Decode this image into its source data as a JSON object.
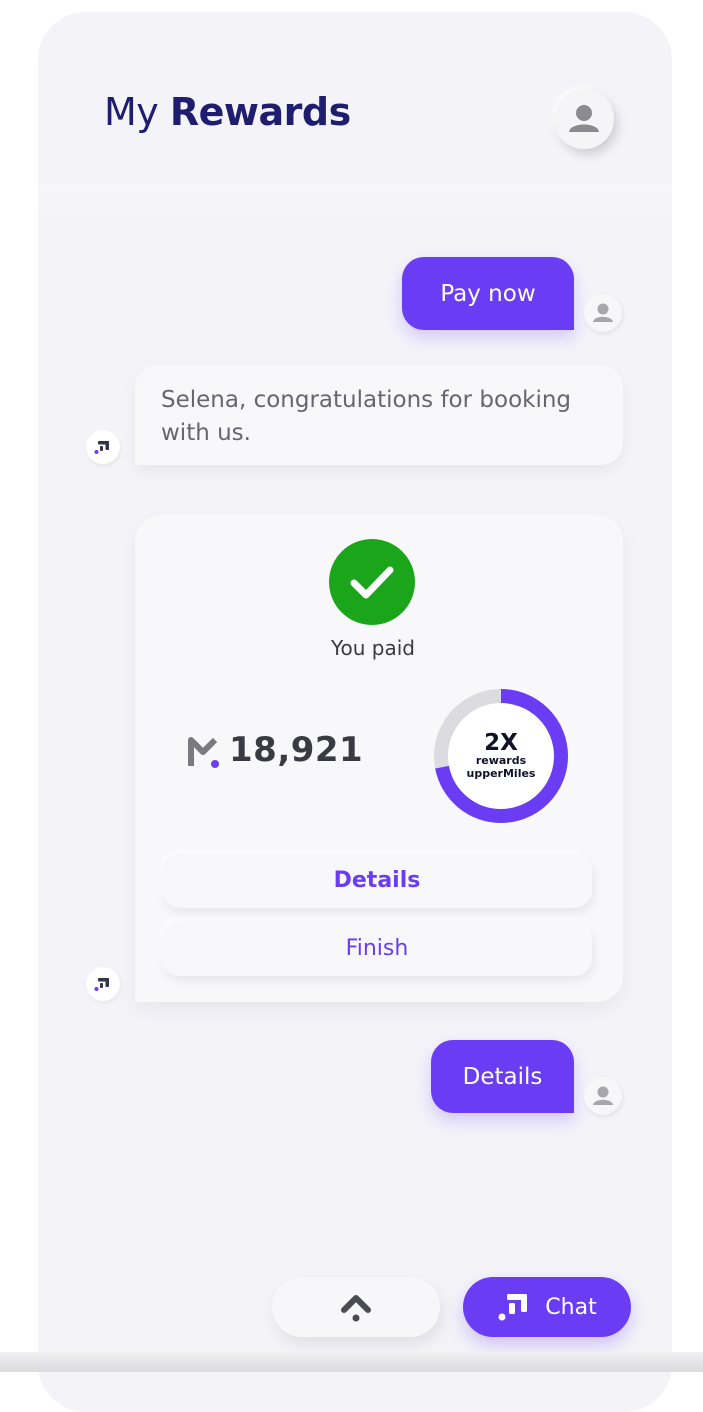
{
  "header": {
    "title_light": "My",
    "title_bold": "Rewards",
    "avatar_icon": "user-avatar-icon"
  },
  "conversation": {
    "user_message_1": "Pay now",
    "bot_message_1": "Selena, congratulations for booking with us.",
    "user_message_2": "Details"
  },
  "payment_card": {
    "status_label": "You paid",
    "status_icon": "check-circle-icon",
    "miles_value": "18,921",
    "miles_logo_icon": "upper-miles-logo-icon",
    "reward_ring": {
      "multiplier": "2X",
      "line1": "rewards",
      "line2": "upperMiles",
      "fill_fraction": 0.72
    },
    "details_button": "Details",
    "finish_button": "Finish"
  },
  "bottom_bar": {
    "scroll_up_icon": "chevron-up-icon",
    "chat_label": "Chat",
    "chat_icon": "chat-logo-icon"
  },
  "colors": {
    "accent": "#6a3df5",
    "title": "#1f1d6e",
    "success": "#1aa51a",
    "background": "#f3f3f8"
  }
}
